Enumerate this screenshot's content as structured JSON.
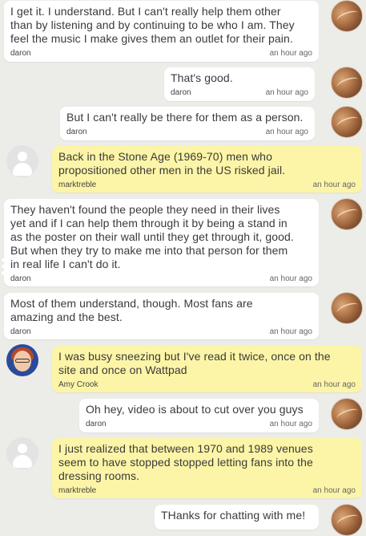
{
  "messages": [
    {
      "author": "daron",
      "time": "an hour ago",
      "kind": "daron",
      "lines": [
        "I get it. I understand. But I can't really help them other",
        "than by listening and by continuing to be who I am. They",
        "feel the music I make gives them an outlet for their pain."
      ]
    },
    {
      "author": "daron",
      "time": "an hour ago",
      "kind": "daron",
      "lines": [
        "That's good."
      ]
    },
    {
      "author": "daron",
      "time": "an hour ago",
      "kind": "daron",
      "lines": [
        "But I can't really be there for them as a person."
      ]
    },
    {
      "author": "marktreble",
      "time": "an hour ago",
      "kind": "other",
      "lines": [
        "Back in the Stone Age (1969-70) men who",
        "propositioned other men in the US risked jail."
      ]
    },
    {
      "author": "daron",
      "time": "an hour ago",
      "kind": "daron",
      "lines": [
        "They haven't found the people they need in their lives",
        "yet and if I can help them through it by being a stand in",
        "as the poster on their wall until they get through it, good.",
        "But when they try to make me into that person for them",
        "in real life I can't do it."
      ]
    },
    {
      "author": "daron",
      "time": "an hour ago",
      "kind": "daron",
      "lines": [
        "Most of them understand, though. Most fans are",
        "amazing and the best."
      ]
    },
    {
      "author": "Amy Crook",
      "time": "an hour ago",
      "kind": "other",
      "lines": [
        "I was busy sneezing but I've read it twice, once on the",
        "site and once on Wattpad"
      ]
    },
    {
      "author": "daron",
      "time": "an hour ago",
      "kind": "daron",
      "lines": [
        "Oh hey, video is about to cut over you guys"
      ]
    },
    {
      "author": "marktreble",
      "time": "an hour ago",
      "kind": "other",
      "lines": [
        "I just realized that between 1970 and 1989 venues",
        "seem to have stopped stopped letting fans into the",
        "dressing rooms."
      ]
    },
    {
      "author": "daron",
      "time": "an hour ago",
      "kind": "daron",
      "lines": [
        "THanks for chatting with me!"
      ]
    }
  ]
}
